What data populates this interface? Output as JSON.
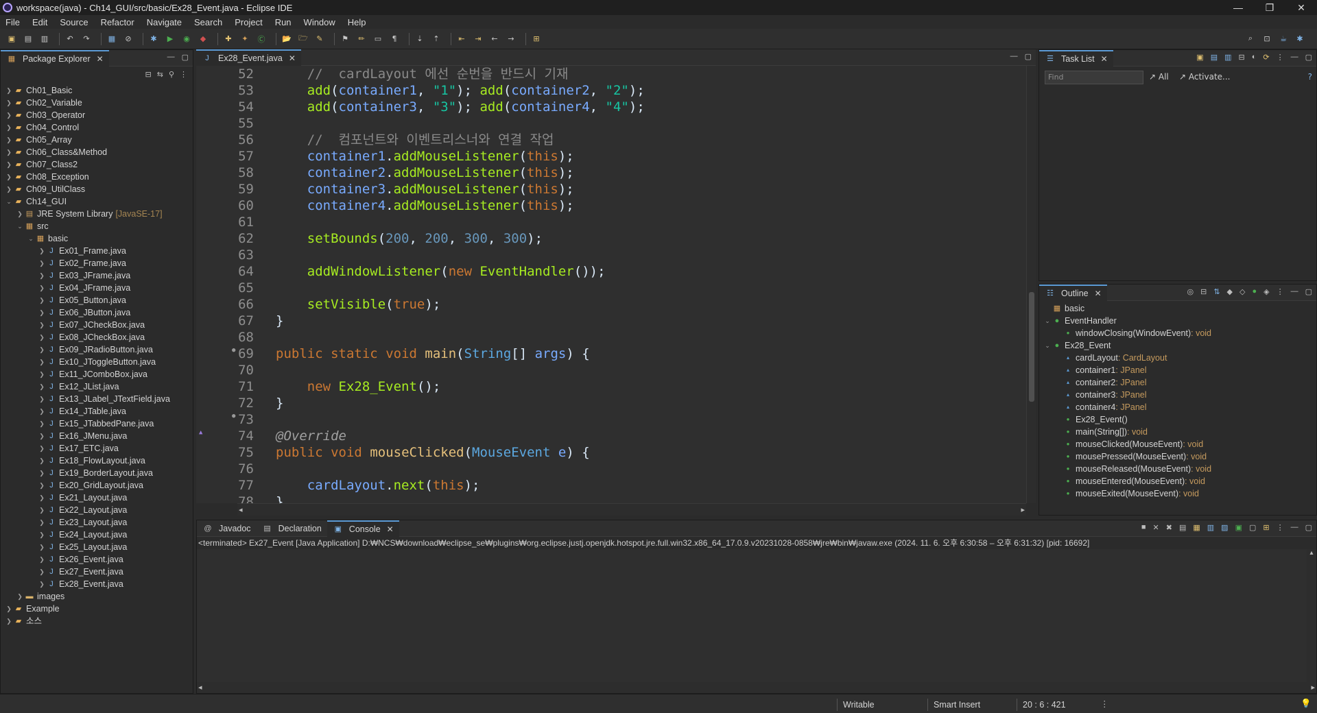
{
  "window": {
    "title": "workspace(java) - Ch14_GUI/src/basic/Ex28_Event.java - Eclipse IDE",
    "minimize": "—",
    "maximize": "❐",
    "close": "✕"
  },
  "menu": [
    "File",
    "Edit",
    "Source",
    "Refactor",
    "Navigate",
    "Search",
    "Project",
    "Run",
    "Window",
    "Help"
  ],
  "package_explorer": {
    "tab_label": "Package Explorer",
    "projects_before": [
      "Ch01_Basic",
      "Ch02_Variable",
      "Ch03_Operator",
      "Ch04_Control",
      "Ch05_Array",
      "Ch06_Class&Method",
      "Ch07_Class2",
      "Ch08_Exception",
      "Ch09_UtilClass"
    ],
    "open_project": "Ch14_GUI",
    "jre": "JRE System Library",
    "jre_version": "[JavaSE-17]",
    "src": "src",
    "package": "basic",
    "files": [
      "Ex01_Frame.java",
      "Ex02_Frame.java",
      "Ex03_JFrame.java",
      "Ex04_JFrame.java",
      "Ex05_Button.java",
      "Ex06_JButton.java",
      "Ex07_JCheckBox.java",
      "Ex08_JCheckBox.java",
      "Ex09_JRadioButton.java",
      "Ex10_JToggleButton.java",
      "Ex11_JComboBox.java",
      "Ex12_JList.java",
      "Ex13_JLabel_JTextField.java",
      "Ex14_JTable.java",
      "Ex15_JTabbedPane.java",
      "Ex16_JMenu.java",
      "Ex17_ETC.java",
      "Ex18_FlowLayout.java",
      "Ex19_BorderLayout.java",
      "Ex20_GridLayout.java",
      "Ex21_Layout.java",
      "Ex22_Layout.java",
      "Ex23_Layout.java",
      "Ex24_Layout.java",
      "Ex25_Layout.java",
      "Ex26_Event.java",
      "Ex27_Event.java",
      "Ex28_Event.java"
    ],
    "images": "images",
    "projects_after": [
      "Example",
      "소스"
    ]
  },
  "editor": {
    "tab_label": "Ex28_Event.java",
    "line_numbers": [
      "52",
      "53",
      "54",
      "55",
      "56",
      "57",
      "58",
      "59",
      "60",
      "61",
      "62",
      "63",
      "64",
      "65",
      "66",
      "67",
      "68",
      "69",
      "70",
      "71",
      "72",
      "73",
      "74",
      "75",
      "76",
      "77",
      "78"
    ],
    "code": {
      "l52": "//  cardLayout 에선 순번을 반드시 기재",
      "l56": "//  컴포넌트와 이벤트리스너와 연결 작업",
      "container1": "container1",
      "container2": "container2",
      "container3": "container3",
      "container4": "container4",
      "s1": "\"1\"",
      "s2": "\"2\"",
      "s3": "\"3\"",
      "s4": "\"4\"",
      "add": "add",
      "addMouseListener": "addMouseListener",
      "this": "this",
      "setBounds": "setBounds",
      "n200": "200",
      "n300": "300",
      "addWindowListener": "addWindowListener",
      "new": "new",
      "EventHandler": "EventHandler",
      "setVisible": "setVisible",
      "true": "true",
      "public": "public",
      "static": "static",
      "void": "void",
      "main": "main",
      "String": "String",
      "args": "args",
      "Ex28_Event": "Ex28_Event",
      "override": "@Override",
      "mouseClicked": "mouseClicked",
      "MouseEvent": "MouseEvent",
      "e": "e",
      "cardLayout": "cardLayout",
      "next": "next"
    }
  },
  "task_list": {
    "tab_label": "Task List",
    "find_placeholder": "Find",
    "all": "All",
    "activate": "Activate..."
  },
  "outline": {
    "tab_label": "Outline",
    "items": [
      {
        "label": "basic",
        "type": ""
      },
      {
        "label": "EventHandler",
        "type": ""
      },
      {
        "label": "windowClosing(WindowEvent)",
        "type": " : void"
      },
      {
        "label": "Ex28_Event",
        "type": ""
      },
      {
        "label": "cardLayout",
        "type": " : CardLayout"
      },
      {
        "label": "container1",
        "type": " : JPanel"
      },
      {
        "label": "container2",
        "type": " : JPanel"
      },
      {
        "label": "container3",
        "type": " : JPanel"
      },
      {
        "label": "container4",
        "type": " : JPanel"
      },
      {
        "label": "Ex28_Event()",
        "type": ""
      },
      {
        "label": "main(String[])",
        "type": " : void"
      },
      {
        "label": "mouseClicked(MouseEvent)",
        "type": " : void"
      },
      {
        "label": "mousePressed(MouseEvent)",
        "type": " : void"
      },
      {
        "label": "mouseReleased(MouseEvent)",
        "type": " : void"
      },
      {
        "label": "mouseEntered(MouseEvent)",
        "type": " : void"
      },
      {
        "label": "mouseExited(MouseEvent)",
        "type": " : void"
      }
    ]
  },
  "bottom_tabs": {
    "javadoc": "Javadoc",
    "declaration": "Declaration",
    "console": "Console"
  },
  "console": {
    "info": "<terminated> Ex27_Event [Java Application] D:₩NCS₩download₩eclipse_se₩plugins₩org.eclipse.justj.openjdk.hotspot.jre.full.win32.x86_64_17.0.9.v20231028-0858₩jre₩bin₩javaw.exe  (2024. 11. 6. 오후 6:30:58 – 오후 6:31:32) [pid: 16692]"
  },
  "status": {
    "writable": "Writable",
    "insert": "Smart Insert",
    "position": "20 : 6 : 421"
  }
}
